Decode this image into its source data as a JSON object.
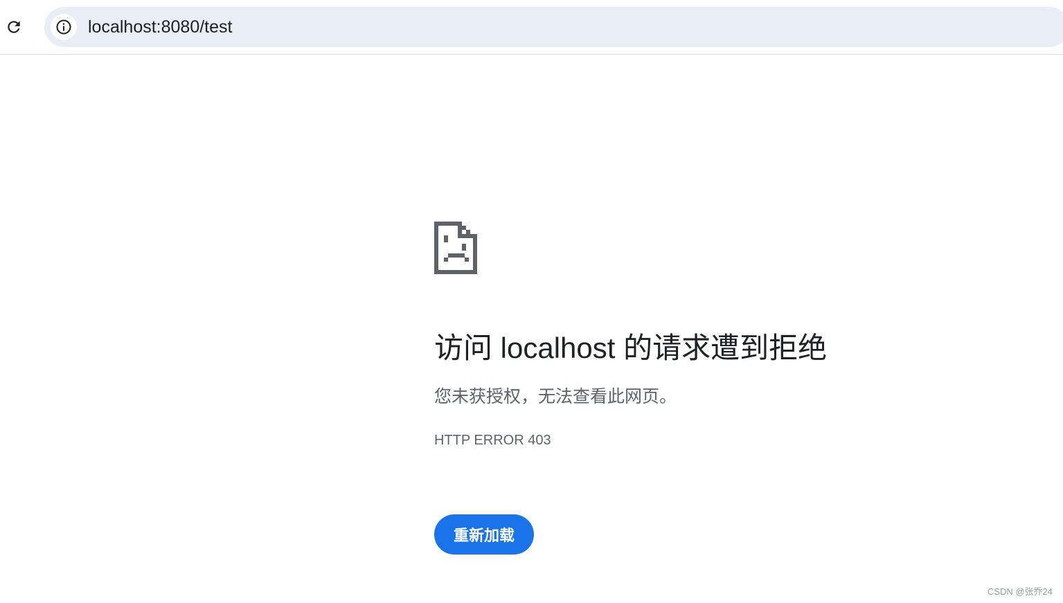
{
  "browser": {
    "url": "localhost:8080/test",
    "icons": {
      "reload": "reload-icon",
      "site_info": "info-icon"
    }
  },
  "error_page": {
    "icon": "sad-page-icon",
    "title": "访问 localhost 的请求遭到拒绝",
    "description": "您未获授权，无法查看此网页。",
    "error_code": "HTTP ERROR 403",
    "reload_label": "重新加载"
  },
  "watermark": "CSDN @张乔24",
  "colors": {
    "accent": "#1a73e8",
    "omnibox_bg": "#e9eef6",
    "title_text": "#202124",
    "secondary_text": "#5f6368",
    "icon_gray": "#5f6368"
  }
}
